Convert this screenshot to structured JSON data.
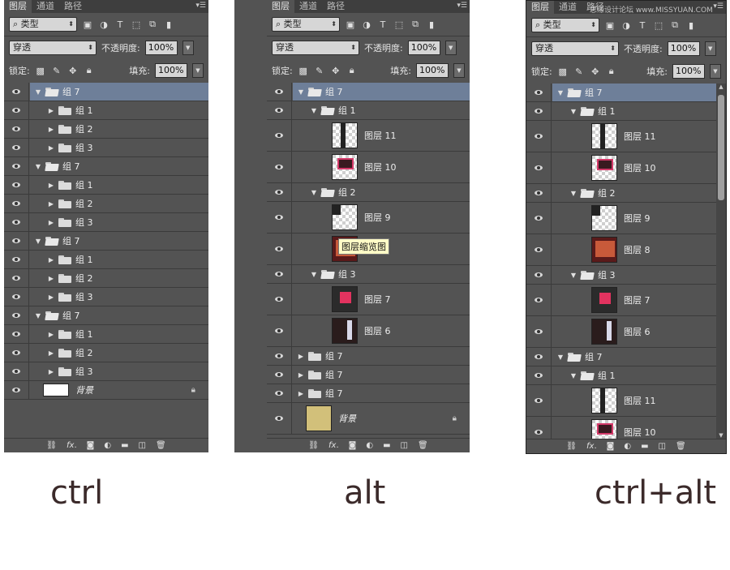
{
  "panel_tabs": [
    "图层",
    "通道",
    "路径"
  ],
  "toolbar": {
    "kind": "类型",
    "blend": "穿透",
    "opacity_label": "不透明度:",
    "opacity": "100%",
    "lock_label": "锁定:",
    "fill_label": "填充:",
    "fill": "100%"
  },
  "tooltip": "图层缩览图",
  "watermark": "思缘设计论坛 www.MISSYUAN.COM",
  "captions": [
    "ctrl",
    "alt",
    "ctrl+alt"
  ],
  "panel1_rows": [
    {
      "name": "组 7",
      "level": 0,
      "type": "group-open",
      "selected": true
    },
    {
      "name": "组 1",
      "level": 1,
      "type": "group"
    },
    {
      "name": "组 2",
      "level": 1,
      "type": "group"
    },
    {
      "name": "组 3",
      "level": 1,
      "type": "group"
    },
    {
      "name": "组 7",
      "level": 0,
      "type": "group-open"
    },
    {
      "name": "组 1",
      "level": 1,
      "type": "group"
    },
    {
      "name": "组 2",
      "level": 1,
      "type": "group"
    },
    {
      "name": "组 3",
      "level": 1,
      "type": "group"
    },
    {
      "name": "组 7",
      "level": 0,
      "type": "group-open"
    },
    {
      "name": "组 1",
      "level": 1,
      "type": "group"
    },
    {
      "name": "组 2",
      "level": 1,
      "type": "group"
    },
    {
      "name": "组 3",
      "level": 1,
      "type": "group"
    },
    {
      "name": "组 7",
      "level": 0,
      "type": "group-open"
    },
    {
      "name": "组 1",
      "level": 1,
      "type": "group"
    },
    {
      "name": "组 2",
      "level": 1,
      "type": "group"
    },
    {
      "name": "组 3",
      "level": 1,
      "type": "group"
    },
    {
      "name": "背景",
      "level": 0,
      "type": "background",
      "thumb": "white"
    }
  ],
  "panel2_rows": [
    {
      "name": "组 7",
      "level": 0,
      "type": "group-open",
      "selected": true
    },
    {
      "name": "组 1",
      "level": 1,
      "type": "group-open"
    },
    {
      "name": "图层 11",
      "level": 2,
      "type": "layer",
      "thumb": "t11"
    },
    {
      "name": "图层 10",
      "level": 2,
      "type": "layer",
      "thumb": "t10"
    },
    {
      "name": "组 2",
      "level": 1,
      "type": "group-open"
    },
    {
      "name": "图层 9",
      "level": 2,
      "type": "layer",
      "thumb": "t9"
    },
    {
      "name": "",
      "level": 2,
      "type": "layer",
      "thumb": "t8",
      "tooltip": true
    },
    {
      "name": "组 3",
      "level": 1,
      "type": "group-open"
    },
    {
      "name": "图层 7",
      "level": 2,
      "type": "layer",
      "thumb": "t7"
    },
    {
      "name": "图层 6",
      "level": 2,
      "type": "layer",
      "thumb": "t6"
    },
    {
      "name": "组 7",
      "level": 0,
      "type": "group"
    },
    {
      "name": "组 7",
      "level": 0,
      "type": "group"
    },
    {
      "name": "组 7",
      "level": 0,
      "type": "group"
    },
    {
      "name": "背景",
      "level": 0,
      "type": "background",
      "thumb": "gold"
    }
  ],
  "panel3_rows": [
    {
      "name": "组 7",
      "level": 0,
      "type": "group-open",
      "selected": true
    },
    {
      "name": "组 1",
      "level": 1,
      "type": "group-open"
    },
    {
      "name": "图层 11",
      "level": 2,
      "type": "layer",
      "thumb": "t11"
    },
    {
      "name": "图层 10",
      "level": 2,
      "type": "layer",
      "thumb": "t10"
    },
    {
      "name": "组 2",
      "level": 1,
      "type": "group-open"
    },
    {
      "name": "图层 9",
      "level": 2,
      "type": "layer",
      "thumb": "t9"
    },
    {
      "name": "图层 8",
      "level": 2,
      "type": "layer",
      "thumb": "t8"
    },
    {
      "name": "组 3",
      "level": 1,
      "type": "group-open"
    },
    {
      "name": "图层 7",
      "level": 2,
      "type": "layer",
      "thumb": "t7"
    },
    {
      "name": "图层 6",
      "level": 2,
      "type": "layer",
      "thumb": "t6"
    },
    {
      "name": "组 7",
      "level": 0,
      "type": "group-open"
    },
    {
      "name": "组 1",
      "level": 1,
      "type": "group-open"
    },
    {
      "name": "图层 11",
      "level": 2,
      "type": "layer",
      "thumb": "t11"
    },
    {
      "name": "图层 10",
      "level": 2,
      "type": "layer",
      "thumb": "t10"
    }
  ],
  "colors": {
    "selected": "#6e7f99",
    "panel": "#535353",
    "caption": "#3b2a2a"
  }
}
